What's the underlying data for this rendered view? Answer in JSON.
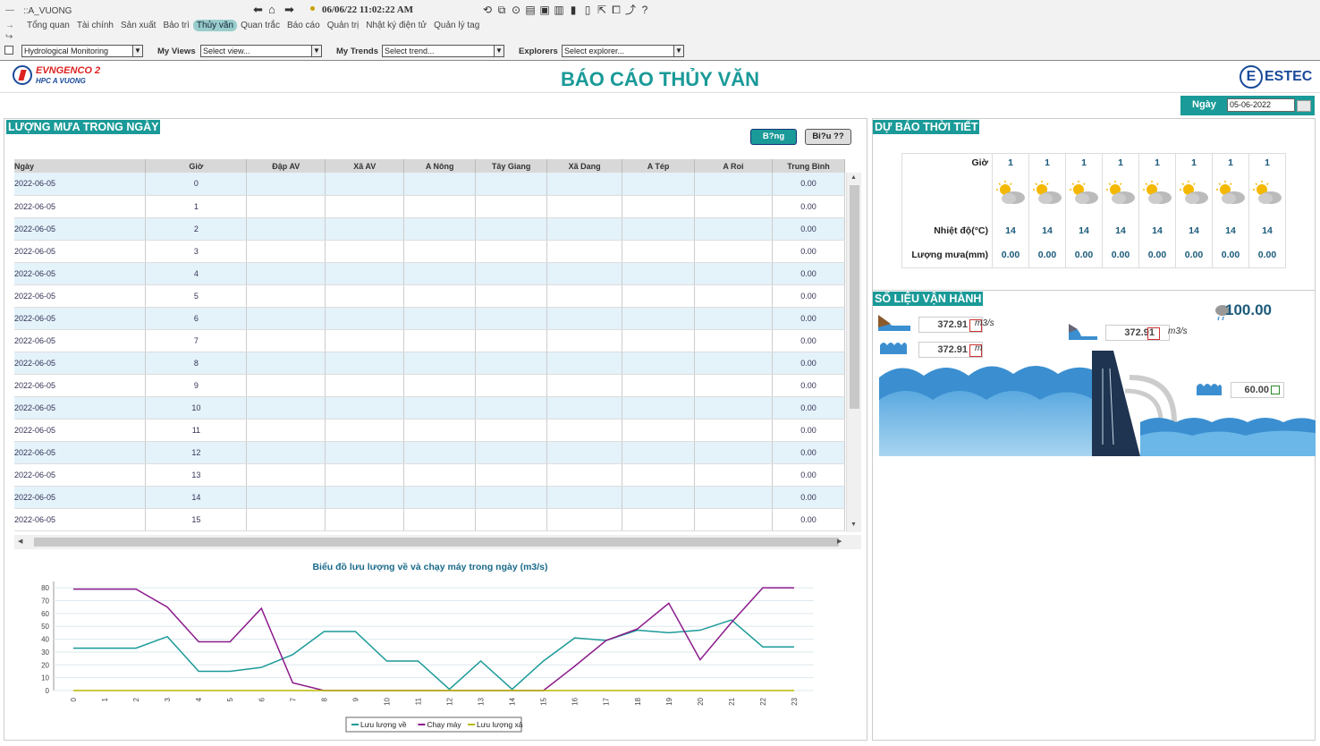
{
  "toolbar": {
    "app_name": "::A_VUONG",
    "datetime": "06/06/22 11:02:22 AM",
    "tabs": [
      "Tổng quan",
      "Tài chính",
      "Sản xuất",
      "Bảo trì",
      "Thủy văn",
      "Quan trắc",
      "Báo cáo",
      "Quản trị",
      "Nhật ký điện tử",
      "Quản lý tag"
    ],
    "active_tab": "Thủy văn"
  },
  "selectors": {
    "display": "Hydrological Monitoring",
    "my_views_label": "My Views",
    "my_views_value": "Select view...",
    "my_trends_label": "My Trends",
    "my_trends_value": "Select trend...",
    "explorers_label": "Explorers",
    "explorers_value": "Select explorer..."
  },
  "header": {
    "logo_brand": "EVNGENCO 2",
    "logo_sub": "HPC A VUONG",
    "title": "BÁO CÁO THỦY VĂN",
    "logo_right": "ESTEC",
    "date_label": "Ngày",
    "date_value": "05-06-2022"
  },
  "rain": {
    "title": "LƯỢNG MƯA TRONG NGÀY",
    "btn_table": "B?ng",
    "btn_chart": "Bi?u ??",
    "columns": [
      "Ngày",
      "Giờ",
      "Đập AV",
      "Xã AV",
      "A Nông",
      "Tây Giang",
      "Xã Dang",
      "A Tép",
      "A Roi",
      "Trung Bình"
    ],
    "rows": [
      [
        "2022-06-05",
        "0",
        "0.00"
      ],
      [
        "2022-06-05",
        "1",
        "0.00"
      ],
      [
        "2022-06-05",
        "2",
        "0.00"
      ],
      [
        "2022-06-05",
        "3",
        "0.00"
      ],
      [
        "2022-06-05",
        "4",
        "0.00"
      ],
      [
        "2022-06-05",
        "5",
        "0.00"
      ],
      [
        "2022-06-05",
        "6",
        "0.00"
      ],
      [
        "2022-06-05",
        "7",
        "0.00"
      ],
      [
        "2022-06-05",
        "8",
        "0.00"
      ],
      [
        "2022-06-05",
        "9",
        "0.00"
      ],
      [
        "2022-06-05",
        "10",
        "0.00"
      ],
      [
        "2022-06-05",
        "11",
        "0.00"
      ],
      [
        "2022-06-05",
        "12",
        "0.00"
      ],
      [
        "2022-06-05",
        "13",
        "0.00"
      ],
      [
        "2022-06-05",
        "14",
        "0.00"
      ],
      [
        "2022-06-05",
        "15",
        "0.00"
      ]
    ]
  },
  "chart_data": {
    "type": "line",
    "title": "Biểu đồ lưu lượng về và chạy máy trong ngày (m3/s)",
    "x": [
      0,
      1,
      2,
      3,
      4,
      5,
      6,
      7,
      8,
      9,
      10,
      11,
      12,
      13,
      14,
      15,
      16,
      17,
      18,
      19,
      20,
      21,
      22,
      23
    ],
    "ylim": [
      0,
      85
    ],
    "yticks": [
      0,
      10,
      20,
      30,
      40,
      50,
      60,
      70,
      80
    ],
    "legend": "bottom",
    "grid": true,
    "series": [
      {
        "name": "Lưu lượng về",
        "color": "#1a9a98",
        "values": [
          33,
          33,
          33,
          42,
          15,
          15,
          18,
          28,
          46,
          46,
          23,
          23,
          1,
          23,
          1,
          23,
          41,
          39,
          47,
          45,
          47,
          55,
          34,
          34
        ]
      },
      {
        "name": "Chạy máy",
        "color": "#8b1a8b",
        "values": [
          79,
          79,
          79,
          65,
          38,
          38,
          64,
          6,
          0,
          0,
          0,
          0,
          0,
          0,
          0,
          0,
          19,
          39,
          48,
          68,
          24,
          53,
          80,
          80
        ]
      },
      {
        "name": "Lưu lượng xả",
        "color": "#b8b800",
        "values": [
          0,
          0,
          0,
          0,
          0,
          0,
          0,
          0,
          0,
          0,
          0,
          0,
          0,
          0,
          0,
          0,
          0,
          0,
          0,
          0,
          0,
          0,
          0,
          0
        ]
      }
    ]
  },
  "weather": {
    "title": "DỰ BÁO THỜI TIẾT",
    "hour_label": "Giờ",
    "temp_label": "Nhiệt độ(°C)",
    "rain_label": "Lượng mưa(mm)",
    "hours": [
      "1",
      "1",
      "1",
      "1",
      "1",
      "1",
      "1",
      "1"
    ],
    "temps": [
      "14",
      "14",
      "14",
      "14",
      "14",
      "14",
      "14",
      "14"
    ],
    "rains": [
      "0.00",
      "0.00",
      "0.00",
      "0.00",
      "0.00",
      "0.00",
      "0.00",
      "0.00"
    ],
    "icon": "partly-sunny-icon"
  },
  "ops": {
    "title": "SỐ LIỆU VẬN HÀNH",
    "rain_value": "100.00",
    "inflow": "372.91",
    "inflow_unit": "m3/s",
    "level": "372.91",
    "level_unit": "m",
    "outflow": "372.91",
    "outflow_unit": "m3/s",
    "downstream": "60.00"
  }
}
